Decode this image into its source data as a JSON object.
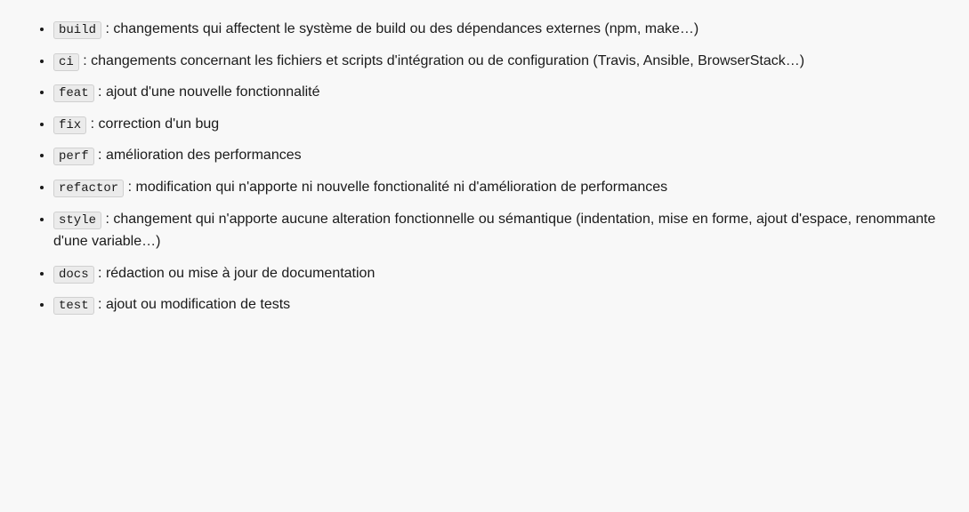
{
  "list": {
    "items": [
      {
        "code": "build",
        "description": " : changements qui affectent le système de build ou des dépendances externes (npm, make…)"
      },
      {
        "code": "ci",
        "description": " : changements concernant les fichiers et scripts d'intégration ou de configuration (Travis, Ansible, BrowserStack…)"
      },
      {
        "code": "feat",
        "description": " : ajout d'une nouvelle fonctionnalité"
      },
      {
        "code": "fix",
        "description": " : correction d'un bug"
      },
      {
        "code": "perf",
        "description": " : amélioration des performances"
      },
      {
        "code": "refactor",
        "description": " : modification qui n'apporte ni nouvelle fonctionalité ni d'amélioration de performances"
      },
      {
        "code": "style",
        "description": " : changement qui n'apporte aucune alteration fonctionnelle ou sémantique (indentation, mise en forme, ajout d'espace, renommante d'une variable…)"
      },
      {
        "code": "docs",
        "description": " : rédaction ou mise à jour de documentation"
      },
      {
        "code": "test",
        "description": " : ajout ou modification de tests"
      }
    ]
  }
}
